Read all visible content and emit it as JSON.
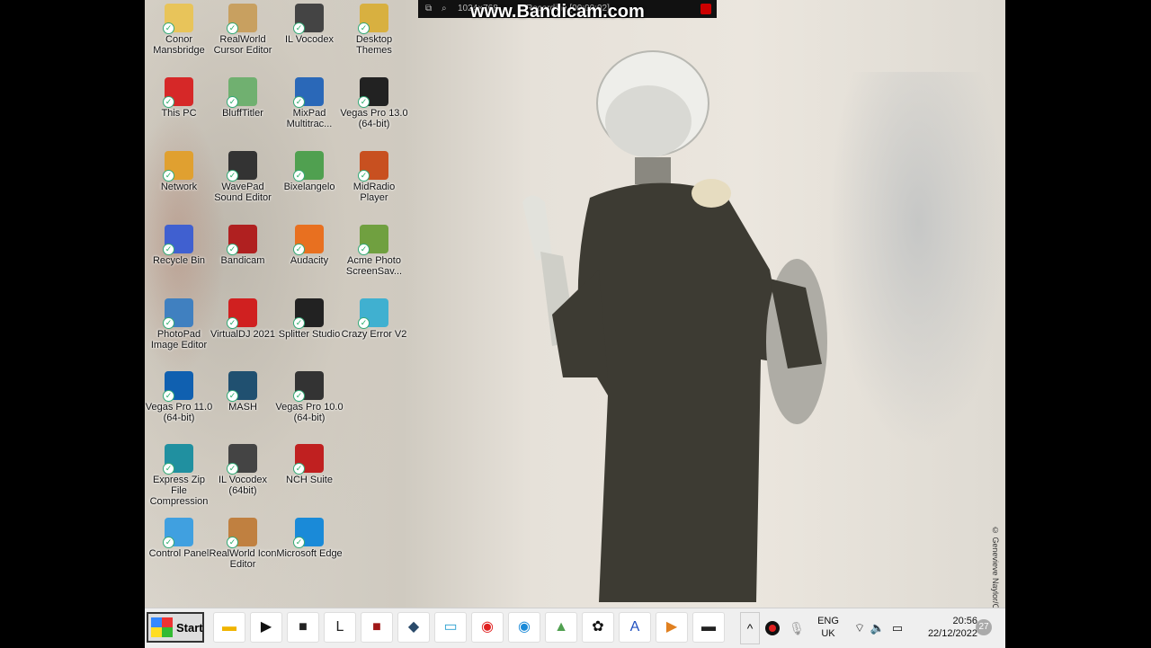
{
  "recorder": {
    "watermark": "www.Bandicam.com",
    "resolution": "1024×768",
    "status": "Recording [00:00:02]"
  },
  "wallpaper": {
    "credit": "© Genevieve Naylor/C"
  },
  "desktop": {
    "icons": [
      {
        "label": "Conor Mansbridge",
        "icon": "folder-user-icon",
        "color": "#e8c45a"
      },
      {
        "label": "RealWorld Cursor Editor",
        "icon": "cursor-editor-icon",
        "color": "#c8a060"
      },
      {
        "label": "IL Vocodex",
        "icon": "vocodex-icon",
        "color": "#444444"
      },
      {
        "label": "Desktop Themes",
        "icon": "themes-icon",
        "color": "#d8b040"
      },
      {
        "label": "This PC",
        "icon": "computer-icon",
        "color": "#d62828"
      },
      {
        "label": "BluffTitler",
        "icon": "bluff-titler-icon",
        "color": "#70b070"
      },
      {
        "label": "MixPad Multitrac...",
        "icon": "mixpad-icon",
        "color": "#2a68b8"
      },
      {
        "label": "Vegas Pro 13.0 (64-bit)",
        "icon": "vegas-icon",
        "color": "#222222"
      },
      {
        "label": "Network",
        "icon": "network-icon",
        "color": "#e0a030"
      },
      {
        "label": "WavePad Sound Editor",
        "icon": "wavepad-icon",
        "color": "#333333"
      },
      {
        "label": "Bixelangelo",
        "icon": "bixelangelo-icon",
        "color": "#50a050"
      },
      {
        "label": "MidRadio Player",
        "icon": "radio-icon",
        "color": "#c85020"
      },
      {
        "label": "Recycle Bin",
        "icon": "recycle-bin-icon",
        "color": "#4060d0"
      },
      {
        "label": "Bandicam",
        "icon": "bandicam-icon",
        "color": "#b02020"
      },
      {
        "label": "Audacity",
        "icon": "audacity-icon",
        "color": "#e87020"
      },
      {
        "label": "Acme Photo ScreenSav...",
        "icon": "photo-screensaver-icon",
        "color": "#70a040"
      },
      {
        "label": "PhotoPad Image Editor",
        "icon": "photopad-icon",
        "color": "#4080c0"
      },
      {
        "label": "VirtualDJ 2021",
        "icon": "virtualdj-icon",
        "color": "#d02020"
      },
      {
        "label": "Splitter Studio",
        "icon": "splitter-icon",
        "color": "#222222"
      },
      {
        "label": "Crazy Error V2",
        "icon": "error-window-icon",
        "color": "#40b0d0"
      },
      {
        "label": "Vegas Pro 11.0 (64-bit)",
        "icon": "vegas-disc-icon",
        "color": "#1060b0"
      },
      {
        "label": "MASH",
        "icon": "mash-icon",
        "color": "#205070"
      },
      {
        "label": "Vegas Pro 10.0 (64-bit)",
        "icon": "vegas10-icon",
        "color": "#333333"
      },
      {
        "label": "",
        "icon": "blank-icon",
        "color": "#00000000"
      },
      {
        "label": "Express Zip File Compression",
        "icon": "zip-icon",
        "color": "#2090a0"
      },
      {
        "label": "IL Vocodex (64bit)",
        "icon": "vocodex-icon",
        "color": "#444444"
      },
      {
        "label": "NCH Suite",
        "icon": "nch-suite-icon",
        "color": "#c02020"
      },
      {
        "label": "",
        "icon": "blank-icon",
        "color": "#00000000"
      },
      {
        "label": "Control Panel",
        "icon": "control-panel-icon",
        "color": "#40a0e0"
      },
      {
        "label": "RealWorld Icon Editor",
        "icon": "icon-editor-icon",
        "color": "#c08040"
      },
      {
        "label": "Microsoft Edge",
        "icon": "edge-icon",
        "color": "#1a8ad8"
      }
    ]
  },
  "taskbar": {
    "start_label": "Start",
    "pinned": [
      {
        "icon": "file-explorer-icon",
        "glyph": "▬",
        "color": "#f0b400"
      },
      {
        "icon": "clapperboard-icon",
        "glyph": "▶",
        "color": "#111111"
      },
      {
        "icon": "store-icon",
        "glyph": "■",
        "color": "#222222"
      },
      {
        "icon": "vocodex-icon",
        "glyph": "L",
        "color": "#222222"
      },
      {
        "icon": "bandicam-icon",
        "glyph": "■",
        "color": "#a01818"
      },
      {
        "icon": "mash-icon",
        "glyph": "◆",
        "color": "#2a4a6a"
      },
      {
        "icon": "crazy-error-icon",
        "glyph": "▭",
        "color": "#2aa0d0"
      },
      {
        "icon": "virtualdj-icon",
        "glyph": "◉",
        "color": "#e02020"
      },
      {
        "icon": "edge-icon",
        "glyph": "◉",
        "color": "#1a8ad8"
      },
      {
        "icon": "blufftitler-icon",
        "glyph": "▲",
        "color": "#50a050"
      },
      {
        "icon": "gear-icon",
        "glyph": "✿",
        "color": "#111111"
      },
      {
        "icon": "ai-app-icon",
        "glyph": "A",
        "color": "#2050c0"
      },
      {
        "icon": "media-player-icon",
        "glyph": "▶",
        "color": "#e08020"
      },
      {
        "icon": "terminal-icon",
        "glyph": "▬",
        "color": "#222222"
      }
    ],
    "tray": {
      "chevron": "^",
      "language_top": "ENG",
      "language_bottom": "UK",
      "time": "20:56",
      "date": "22/12/2022",
      "notification_count": "27"
    }
  }
}
